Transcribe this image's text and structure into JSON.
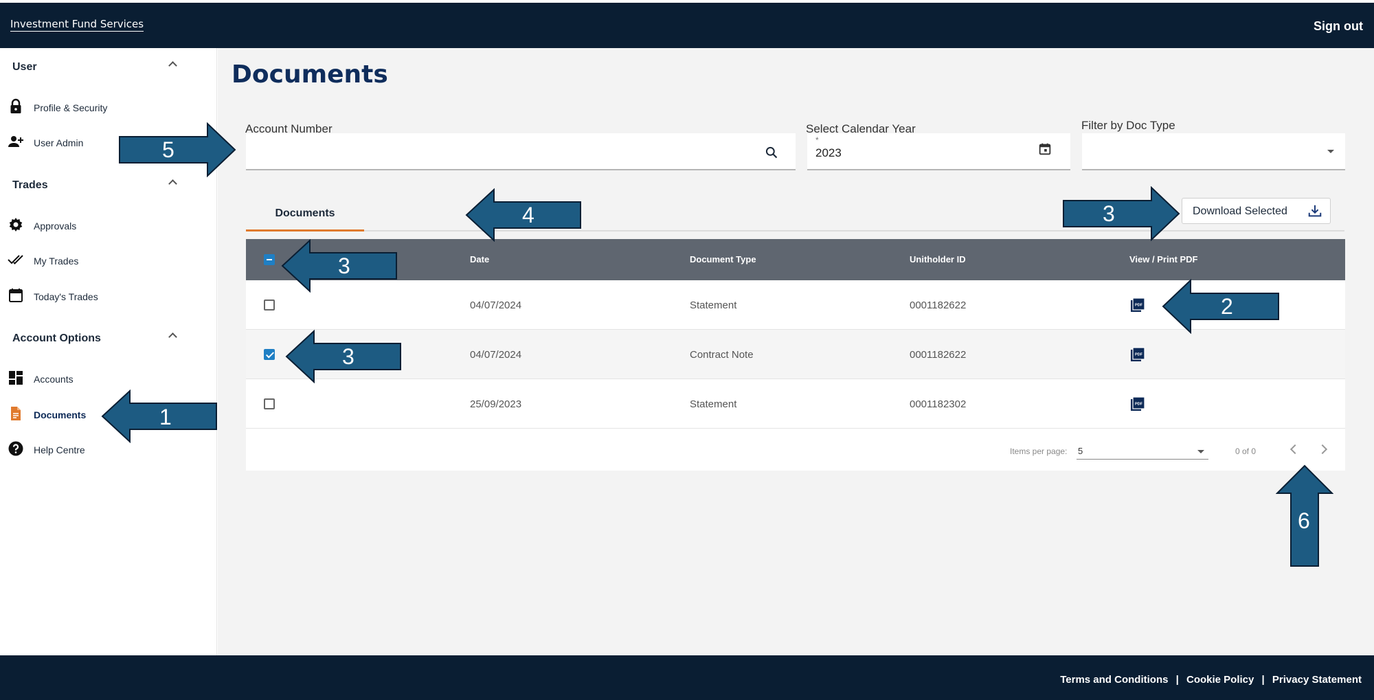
{
  "header": {
    "brand": "Investment Fund Services",
    "sign_out": "Sign out"
  },
  "sidebar": {
    "sections": [
      {
        "title": "User",
        "items": [
          {
            "label": "Profile & Security",
            "icon": "lock-icon"
          },
          {
            "label": "User Admin",
            "icon": "user-add-icon"
          }
        ]
      },
      {
        "title": "Trades",
        "items": [
          {
            "label": "Approvals",
            "icon": "gear-icon"
          },
          {
            "label": "My Trades",
            "icon": "double-check-icon"
          },
          {
            "label": "Today's Trades",
            "icon": "calendar-icon"
          }
        ]
      },
      {
        "title": "Account Options",
        "items": [
          {
            "label": "Accounts",
            "icon": "dashboard-icon"
          },
          {
            "label": "Documents",
            "icon": "document-icon",
            "active": true
          },
          {
            "label": "Help Centre",
            "icon": "help-icon"
          }
        ]
      }
    ]
  },
  "main": {
    "title": "Documents",
    "filters": {
      "account_number": {
        "label": "Account Number",
        "value": ""
      },
      "calendar_year": {
        "label": "Select Calendar Year",
        "value": "2023",
        "required_mark": "*"
      },
      "doc_type": {
        "label": "Filter by Doc Type",
        "value": ""
      }
    },
    "tabs": [
      {
        "label": "Documents",
        "active": true
      }
    ],
    "download_button": "Download Selected",
    "table": {
      "columns": [
        "Date",
        "Document Type",
        "Unitholder ID",
        "View / Print PDF"
      ],
      "rows": [
        {
          "date": "04/07/2024",
          "type": "Statement",
          "unitholder": "0001182622",
          "checked": false
        },
        {
          "date": "04/07/2024",
          "type": "Contract Note",
          "unitholder": "0001182622",
          "checked": true
        },
        {
          "date": "25/09/2023",
          "type": "Statement",
          "unitholder": "0001182302",
          "checked": false
        }
      ]
    },
    "paginator": {
      "items_per_page_label": "Items per page:",
      "items_per_page": "5",
      "range": "0 of 0"
    }
  },
  "footer": {
    "links": [
      "Terms and Conditions",
      "Cookie Policy",
      "Privacy Statement"
    ],
    "separator": "|"
  },
  "annotations": [
    "1",
    "2",
    "3",
    "4",
    "5",
    "6"
  ],
  "colors": {
    "header_bg": "#0a1e33",
    "accent_orange": "#e07a2e",
    "arrow_fill": "#1d5b82",
    "checkbox_blue": "#1f7fc4",
    "title_blue": "#0f2d5c"
  }
}
